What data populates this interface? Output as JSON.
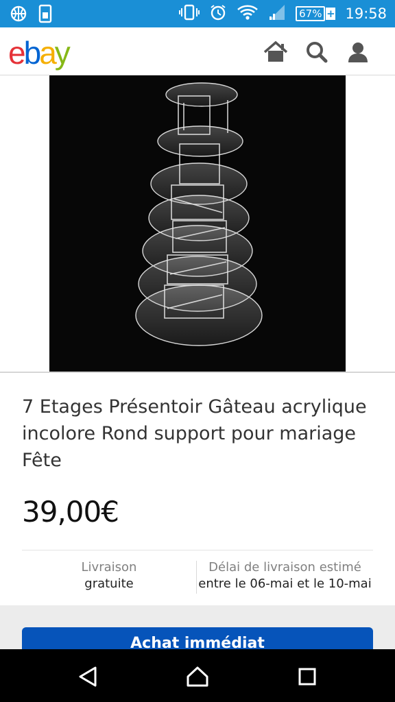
{
  "status_bar": {
    "battery": "67%",
    "battery_plus": "+",
    "time": "19:58",
    "icons": [
      "basketball-icon",
      "sim-icon",
      "vibrate-icon",
      "alarm-icon",
      "wifi-icon",
      "signal-icon"
    ]
  },
  "app": {
    "logo_letters": [
      "e",
      "b",
      "a",
      "y"
    ],
    "logo_colors": [
      "#e53238",
      "#0064d2",
      "#f5af02",
      "#86b817"
    ],
    "icons": [
      "home-icon",
      "search-icon",
      "user-icon"
    ]
  },
  "listing": {
    "title": "7 Etages Présentoir Gâteau acrylique incolore Rond support pour mariage Fête",
    "price": "39,00€"
  },
  "shipping": {
    "label": "Livraison",
    "value": "gratuite",
    "estimate_label": "Délai de livraison estimé",
    "estimate_value": "entre le 06-mai et le 10-mai"
  },
  "buy_button": {
    "label": "Achat immédiat"
  },
  "nav": {
    "icons": [
      "back-icon",
      "home-circle-icon",
      "recents-icon"
    ]
  },
  "colors": {
    "status_bar": "#1a8fd6",
    "buy_button": "#0654ba"
  }
}
